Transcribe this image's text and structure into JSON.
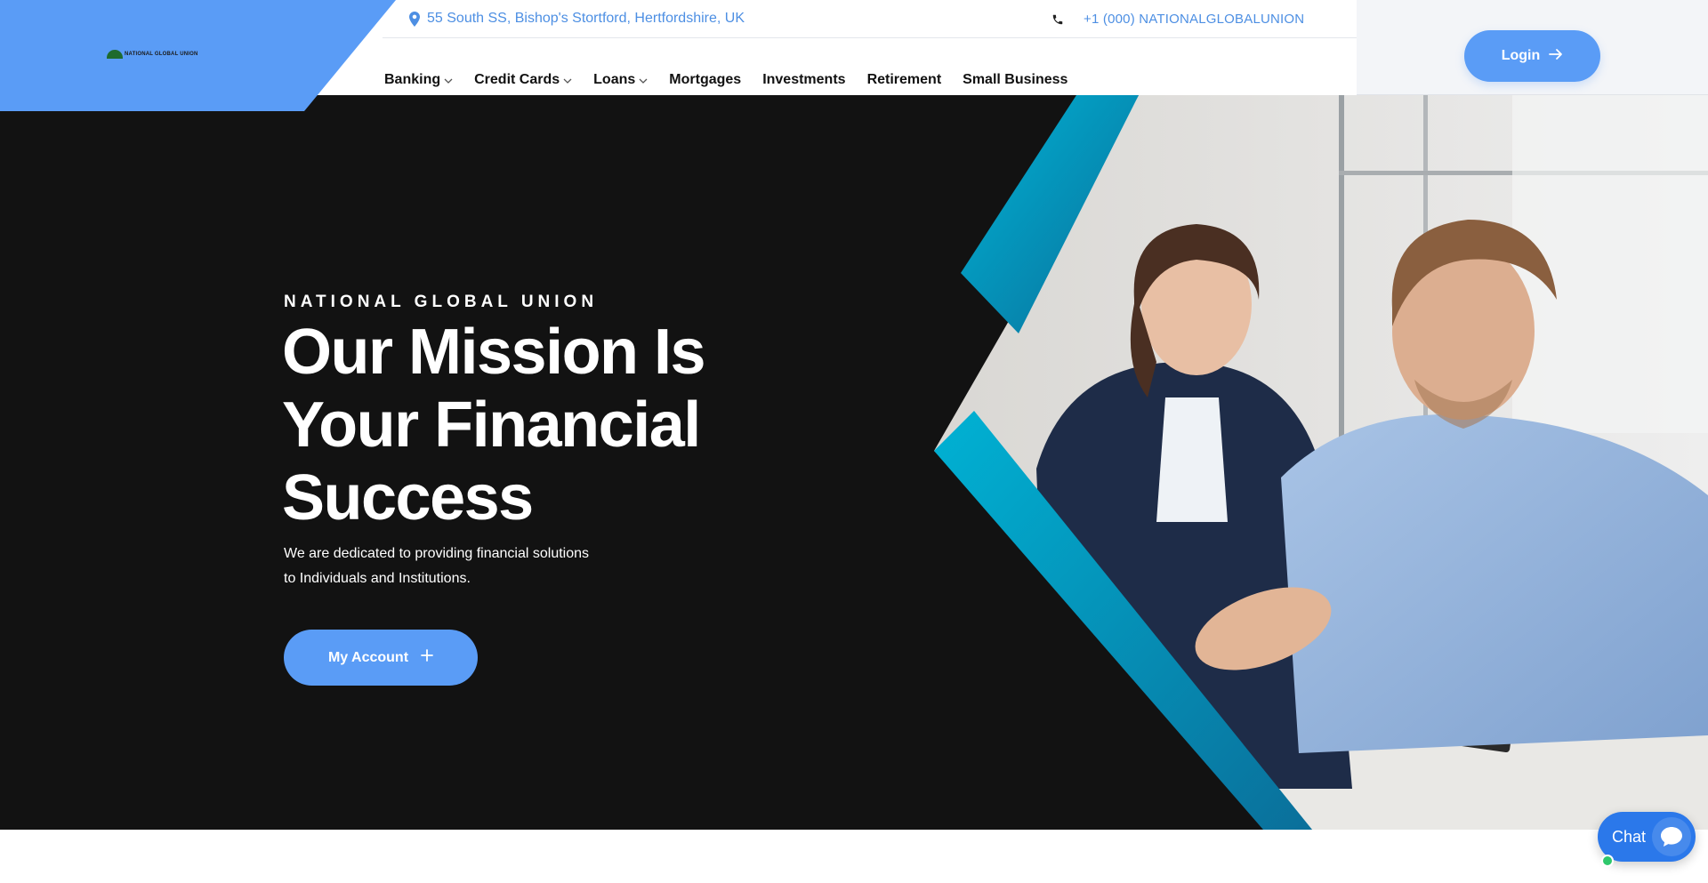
{
  "brand": {
    "logo_text": "NATIONAL GLOBAL UNION",
    "primary_color": "#5a9cf6",
    "accent_color": "#0aa3c8"
  },
  "topbar": {
    "address": "55 South SS, Bishop's Stortford, Hertfordshire, UK",
    "address_icon": "map-pin-icon",
    "phone": "+1 (000) NATIONALGLOBALUNION",
    "phone_icon": "phone-icon"
  },
  "nav": {
    "items": [
      {
        "label": "Banking",
        "dropdown": true
      },
      {
        "label": "Credit Cards",
        "dropdown": true
      },
      {
        "label": "Loans",
        "dropdown": true
      },
      {
        "label": "Mortgages",
        "dropdown": false
      },
      {
        "label": "Investments",
        "dropdown": false
      },
      {
        "label": "Retirement",
        "dropdown": false
      },
      {
        "label": "Small Business",
        "dropdown": false
      }
    ],
    "login_label": "Login",
    "login_icon": "arrow-right-icon"
  },
  "hero": {
    "eyebrow": "NATIONAL GLOBAL UNION",
    "title_lines": [
      "Our Mission Is",
      "Your Financial",
      "Success"
    ],
    "description_lines": [
      "We are dedicated to providing financial solutions",
      "to Individuals and Institutions."
    ],
    "cta_label": "My Account",
    "cta_icon": "plus-icon",
    "image": "two-colleagues-smiling-at-desk"
  },
  "chat": {
    "label": "Chat",
    "icon": "chat-bubble-icon",
    "status": "online"
  }
}
